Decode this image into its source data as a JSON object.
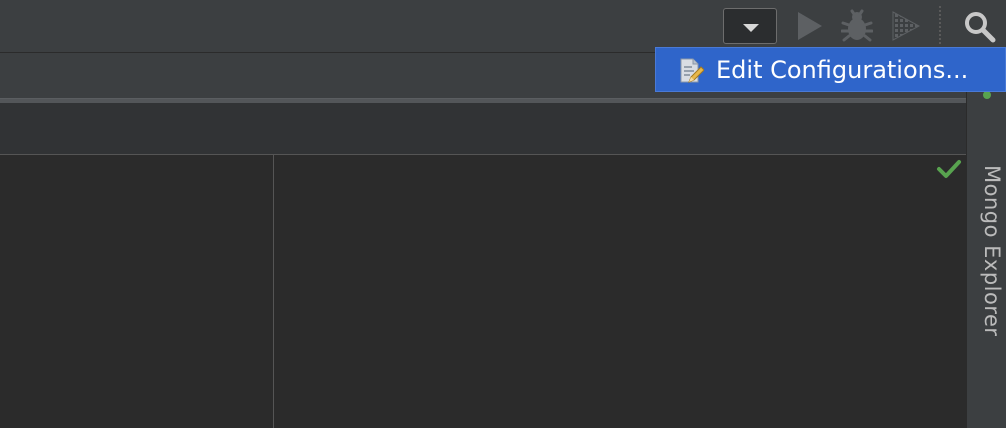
{
  "toolbar": {
    "run_config_dropdown": "",
    "icons": {
      "dropdown": "chevron-down-icon",
      "run": "run-icon",
      "debug": "bug-icon",
      "coverage": "coverage-icon",
      "search": "search-icon"
    }
  },
  "popup": {
    "label": "Edit Configurations...",
    "icon": "edit-configurations-icon"
  },
  "right_tool_window": {
    "label": "Mongo Explorer"
  },
  "editor": {
    "status_icon": "checkmark-icon"
  },
  "colors": {
    "popup_highlight": "#2f65ca",
    "toolbar_bg": "#3c3f41",
    "editor_bg": "#2b2b2b",
    "checkmark": "#58a34f"
  }
}
